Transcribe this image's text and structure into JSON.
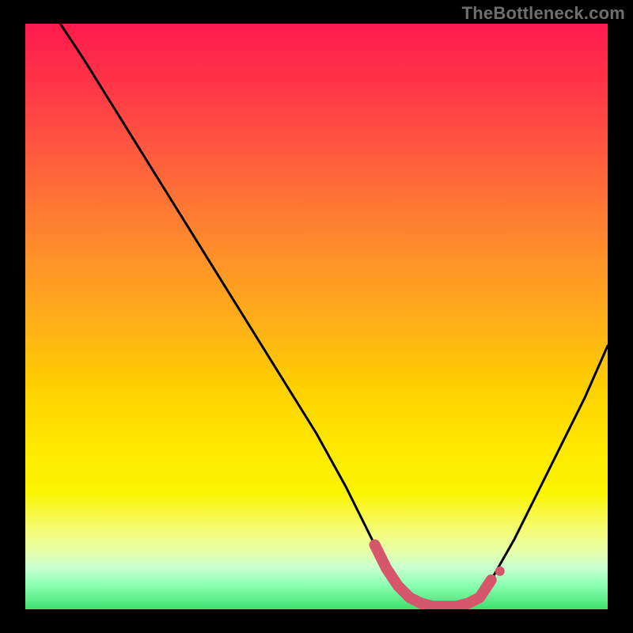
{
  "watermark": "TheBottleneck.com",
  "colors": {
    "frame": "#000000",
    "curve": "#000000",
    "marker_stroke": "#d6566c",
    "marker_fill": "#d6566c",
    "gradient_top": "#ff1a4d",
    "gradient_bottom": "#3fe06e"
  },
  "chart_data": {
    "type": "line",
    "title": "",
    "xlabel": "",
    "ylabel": "",
    "xlim": [
      0,
      100
    ],
    "ylim": [
      0,
      100
    ],
    "series": [
      {
        "name": "bottleneck-curve",
        "x": [
          6,
          10,
          15,
          20,
          25,
          30,
          35,
          40,
          45,
          50,
          55,
          58,
          60,
          62,
          64,
          66,
          68,
          70,
          72,
          74,
          76,
          78,
          80,
          84,
          88,
          92,
          96,
          100
        ],
        "y": [
          100,
          94,
          86,
          78,
          70,
          62,
          54,
          46,
          38,
          30,
          21,
          15,
          11,
          7,
          4,
          2,
          1,
          0.5,
          0.5,
          0.5,
          1,
          2,
          5,
          12,
          20,
          28,
          36,
          45
        ]
      }
    ],
    "markers": {
      "name": "highlight-band",
      "x": [
        60,
        62,
        64,
        66,
        68,
        70,
        72,
        74,
        76,
        78,
        80
      ],
      "y": [
        11,
        7,
        4,
        2,
        1,
        0.5,
        0.5,
        0.5,
        1,
        2,
        5
      ]
    }
  }
}
